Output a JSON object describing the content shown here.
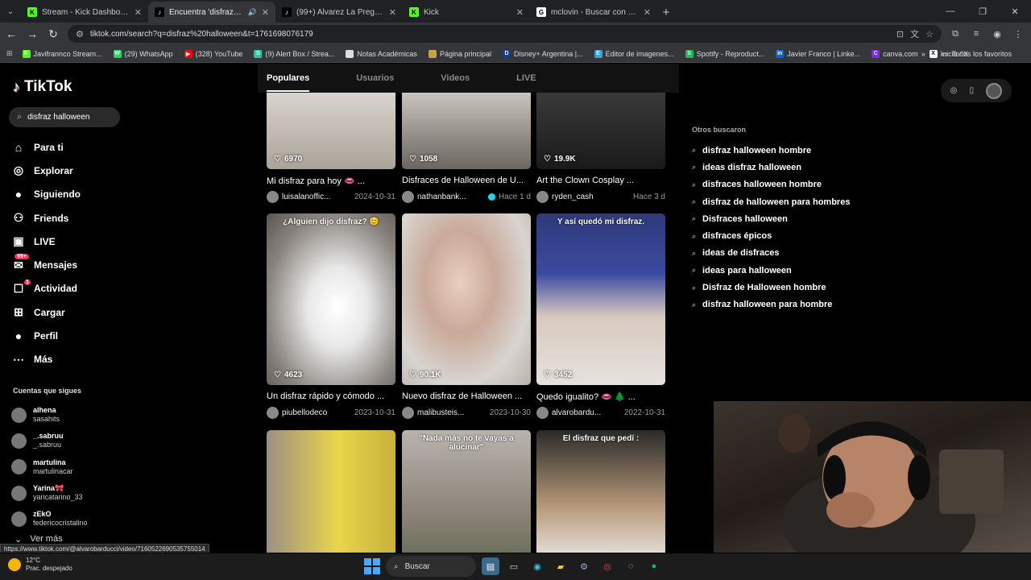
{
  "browser": {
    "tabs": [
      {
        "title": "Stream - Kick Dashboard",
        "color": "#53fc18",
        "glyph": "K",
        "active": false
      },
      {
        "title": "Encuentra 'disfraz hallowee",
        "color": "#000000",
        "glyph": "♪",
        "active": true
      },
      {
        "title": "(99+) Alvarez La Pregunta: Exc",
        "color": "#000000",
        "glyph": "♪",
        "active": false
      },
      {
        "title": "Kick",
        "color": "#53fc18",
        "glyph": "K",
        "active": false
      },
      {
        "title": "mclovin - Buscar con Google",
        "color": "#ffffff",
        "glyph": "G",
        "active": false
      }
    ],
    "url": "tiktok.com/search?q=disfraz%20halloween&t=1761698076179",
    "bookmarks": [
      {
        "label": "Javifrannco Stream...",
        "color": "#53fc18",
        "glyph": "K"
      },
      {
        "label": "(29) WhatsApp",
        "color": "#25d366",
        "glyph": "W"
      },
      {
        "label": "(328) YouTube",
        "color": "#ff0000",
        "glyph": "▶"
      },
      {
        "label": "(9) Alert Box / Strea...",
        "color": "#31c3a2",
        "glyph": "S"
      },
      {
        "label": "Notas Académicas",
        "color": "#dddddd",
        "glyph": ""
      },
      {
        "label": "Página principal",
        "color": "#c8a24a",
        "glyph": ""
      },
      {
        "label": "Disney+ Argentina |...",
        "color": "#1a3a8a",
        "glyph": "D"
      },
      {
        "label": "Editor de imagenes...",
        "color": "#3aa0d8",
        "glyph": "E"
      },
      {
        "label": "Spotify - Reproduct...",
        "color": "#1db954",
        "glyph": "S"
      },
      {
        "label": "Javier Franco | Linke...",
        "color": "#0a66c2",
        "glyph": "in"
      },
      {
        "label": "canva.com",
        "color": "#7d2ae8",
        "glyph": "C"
      },
      {
        "label": "Inicio / X",
        "color": "#ffffff",
        "glyph": "X"
      }
    ],
    "bookmarks_right": "Todos los favoritos",
    "status_url": "https://www.tiktok.com/@alvarobarducci/video/7160522690535755014"
  },
  "tiktok": {
    "logo": "TikTok",
    "search_value": "disfraz halloween",
    "nav": [
      {
        "label": "Para ti",
        "icon": "home-icon",
        "glyph": "⌂"
      },
      {
        "label": "Explorar",
        "icon": "compass-icon",
        "glyph": "◎"
      },
      {
        "label": "Siguiendo",
        "icon": "following-avatar-icon",
        "glyph": "●"
      },
      {
        "label": "Friends",
        "icon": "friends-icon",
        "glyph": "⚇"
      },
      {
        "label": "LIVE",
        "icon": "live-icon",
        "glyph": "▣"
      },
      {
        "label": "Mensajes",
        "icon": "messages-icon",
        "glyph": "✉",
        "badge": "99+"
      },
      {
        "label": "Actividad",
        "icon": "activity-icon",
        "glyph": "☐",
        "badge": "1"
      },
      {
        "label": "Cargar",
        "icon": "upload-icon",
        "glyph": "⊞"
      },
      {
        "label": "Perfil",
        "icon": "profile-icon",
        "glyph": "●"
      },
      {
        "label": "Más",
        "icon": "more-icon",
        "glyph": "⋯"
      }
    ],
    "following_title": "Cuentas que sigues",
    "following": [
      {
        "name": "alhena",
        "handle": "sasahits"
      },
      {
        "name": "_.sabruu",
        "handle": "_.sabruu"
      },
      {
        "name": "martulina",
        "handle": "martulinacar"
      },
      {
        "name": "Yarina🎀",
        "handle": "yaricatarino_33"
      },
      {
        "name": "zEkO",
        "handle": "federicocristalino"
      }
    ],
    "ver_mas": "Ver más",
    "result_tabs": [
      "Populares",
      "Usuarios",
      "Videos",
      "LIVE"
    ],
    "videos": [
      {
        "likes": "6970",
        "desc": "Mi disfraz para hoy 👄 ...",
        "user": "luisalanoffic...",
        "date": "2024-10-31",
        "verified": false,
        "bg": "linear-gradient(180deg,#d9d4cc,#a9a39a)",
        "overlay": ""
      },
      {
        "likes": "1058",
        "desc": "Disfraces de Halloween de U...",
        "user": "nathanbank...",
        "date": "Hace 1 d",
        "verified": true,
        "bg": "linear-gradient(180deg,#c9c4bc,#6a6660)",
        "overlay": ""
      },
      {
        "likes": "19.9K",
        "desc": "Art the Clown Cosplay ...",
        "user": "ryden_cash",
        "date": "Hace 3 d",
        "verified": false,
        "bg": "linear-gradient(180deg,#3a3a3a,#1a1a1a)",
        "overlay": ""
      },
      {
        "likes": "4623",
        "desc": "Un disfraz rápido y cómodo ...",
        "user": "piubellodeco",
        "date": "2023-10-31",
        "verified": false,
        "bg": "radial-gradient(ellipse at 55% 55%,#ffffff 0%,#e8e8e8 30%,#8a8580 70%,#5a554f 100%)",
        "overlay": "¿Alguien dijo disfraz? 😊"
      },
      {
        "likes": "90.1K",
        "desc": "Nuevo disfraz de Halloween ...",
        "user": "malibusteis...",
        "date": "2023-10-30",
        "verified": false,
        "bg": "radial-gradient(ellipse at 45% 40%,#e8cfc0 0%,#c9a99a 35%,#d8d4cf 70%,#b8b2aa 100%)",
        "overlay": ""
      },
      {
        "likes": "3452",
        "desc": "Quedo igualito? 👄 🌲 ...",
        "user": "alvarobardu...",
        "date": "2022-10-31",
        "verified": false,
        "bg": "linear-gradient(180deg,#2f3a7a 0%,#3a4aa0 35%,#d9c8c0 60%,#e6e1dc 100%)",
        "overlay": "Y así quedó mi disfraz."
      },
      {
        "likes": "",
        "desc": "",
        "user": "",
        "date": "",
        "verified": false,
        "bg": "linear-gradient(90deg,#9c8f82 0%,#e9d64a 55%,#c7b13a 100%)",
        "overlay": ""
      },
      {
        "likes": "",
        "desc": "",
        "user": "",
        "date": "",
        "verified": false,
        "bg": "linear-gradient(180deg,#b9b3ac 0%,#8a8278 50%,#4a5a3a 100%)",
        "overlay": "\"Nada más no te vayas a alucinar\""
      },
      {
        "likes": "",
        "desc": "",
        "user": "",
        "date": "",
        "verified": false,
        "bg": "linear-gradient(180deg,#2a2a2a 0%,#b89a7a 45%,#e6e3df 75%,#c44 100%)",
        "overlay": "El disfraz que pedí :"
      }
    ],
    "related_title": "Otros buscaron",
    "related": [
      "disfraz halloween hombre",
      "ideas disfraz halloween",
      "disfraces halloween hombre",
      "disfraz de halloween para hombres",
      "Disfraces halloween",
      "disfraces épicos",
      "ideas de disfraces",
      "ideas para halloween",
      "Disfraz de Halloween hombre",
      "disfraz halloween para hombre"
    ]
  },
  "taskbar": {
    "temp": "12°C",
    "weather": "Prac. despejado",
    "search_label": "Buscar"
  }
}
